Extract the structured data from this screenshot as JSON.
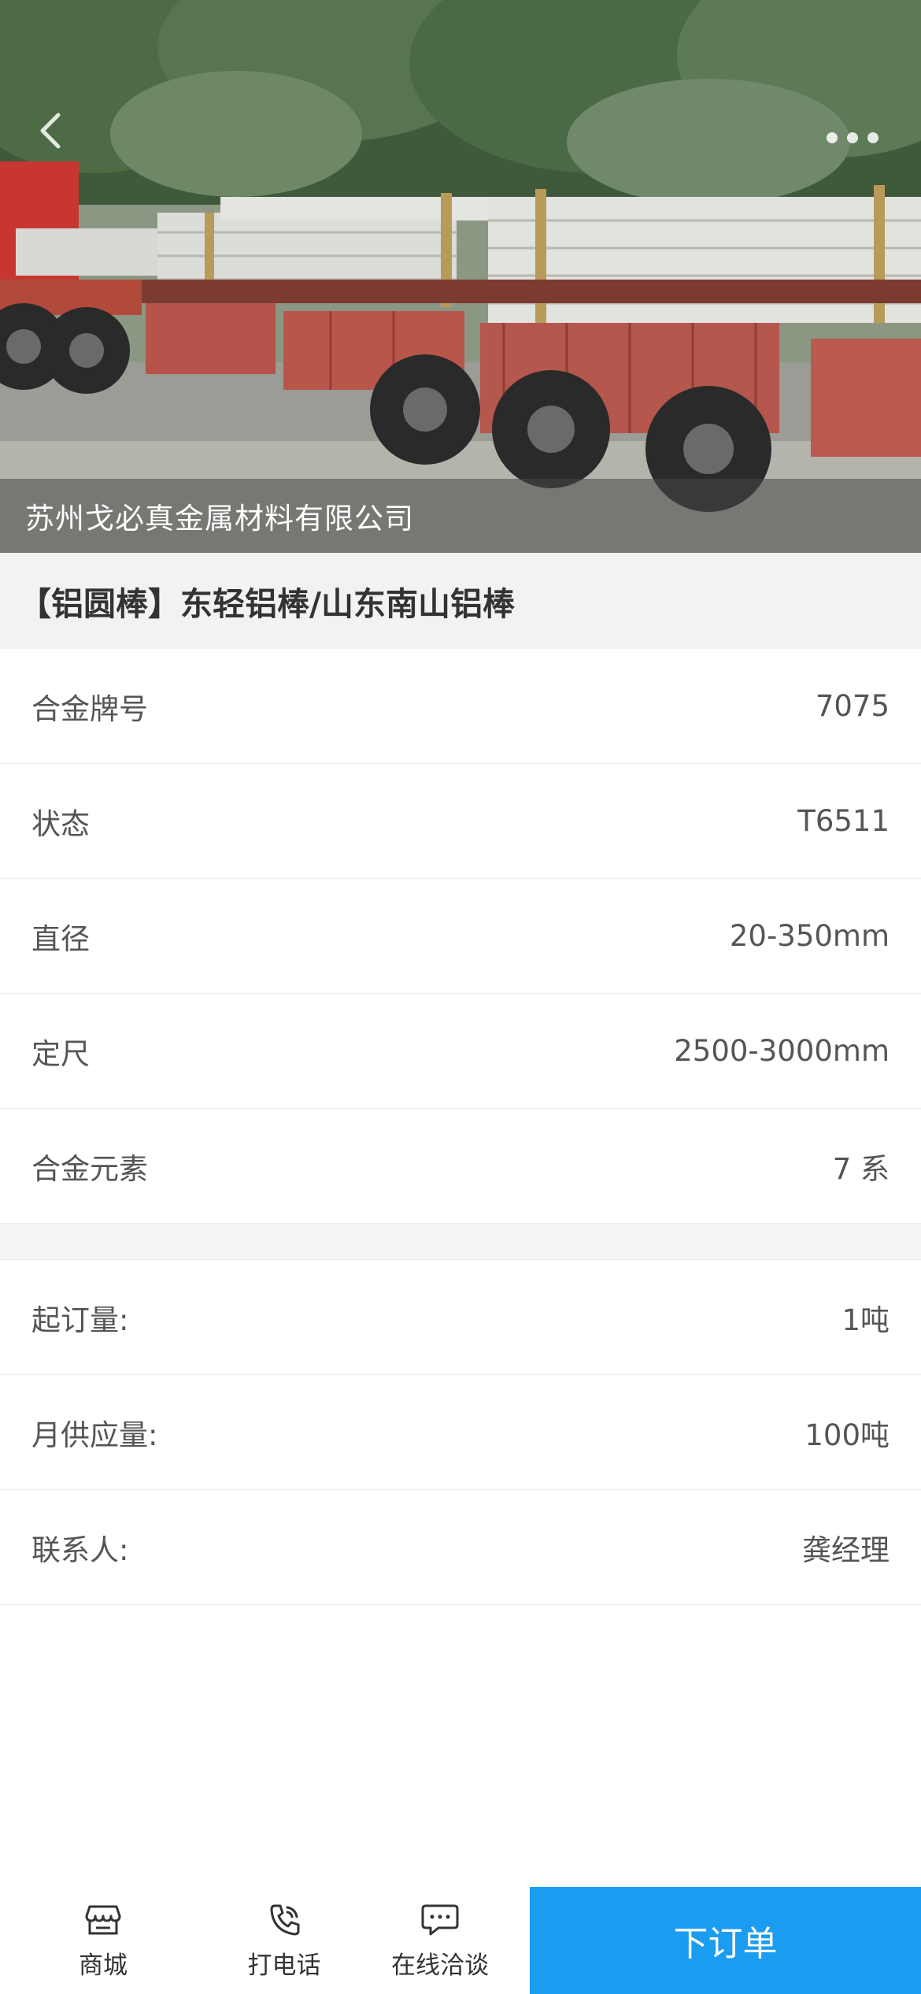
{
  "hero": {
    "company_name": "苏州戈必真金属材料有限公司",
    "back_icon": "chevron-left-icon",
    "more_icon": "more-dots-icon"
  },
  "product": {
    "title": "【铝圆棒】东轻铝棒/山东南山铝棒"
  },
  "specs": [
    {
      "label": "合金牌号",
      "value": "7075"
    },
    {
      "label": "状态",
      "value": "T6511"
    },
    {
      "label": "直径",
      "value": "20-350mm"
    },
    {
      "label": "定尺",
      "value": "2500-3000mm"
    },
    {
      "label": "合金元素",
      "value": "7 系"
    }
  ],
  "order_info": [
    {
      "label": "起订量:",
      "value": "1吨"
    },
    {
      "label": "月供应量:",
      "value": "100吨"
    },
    {
      "label": "联系人:",
      "value": "龚经理"
    }
  ],
  "bottom_bar": {
    "items": [
      {
        "label": "商城",
        "icon": "shop-icon"
      },
      {
        "label": "打电话",
        "icon": "phone-icon"
      },
      {
        "label": "在线洽谈",
        "icon": "chat-icon"
      }
    ],
    "order_button": "下订单"
  },
  "colors": {
    "accent": "#1a9cf0",
    "title_bg": "#f2f2f2"
  }
}
